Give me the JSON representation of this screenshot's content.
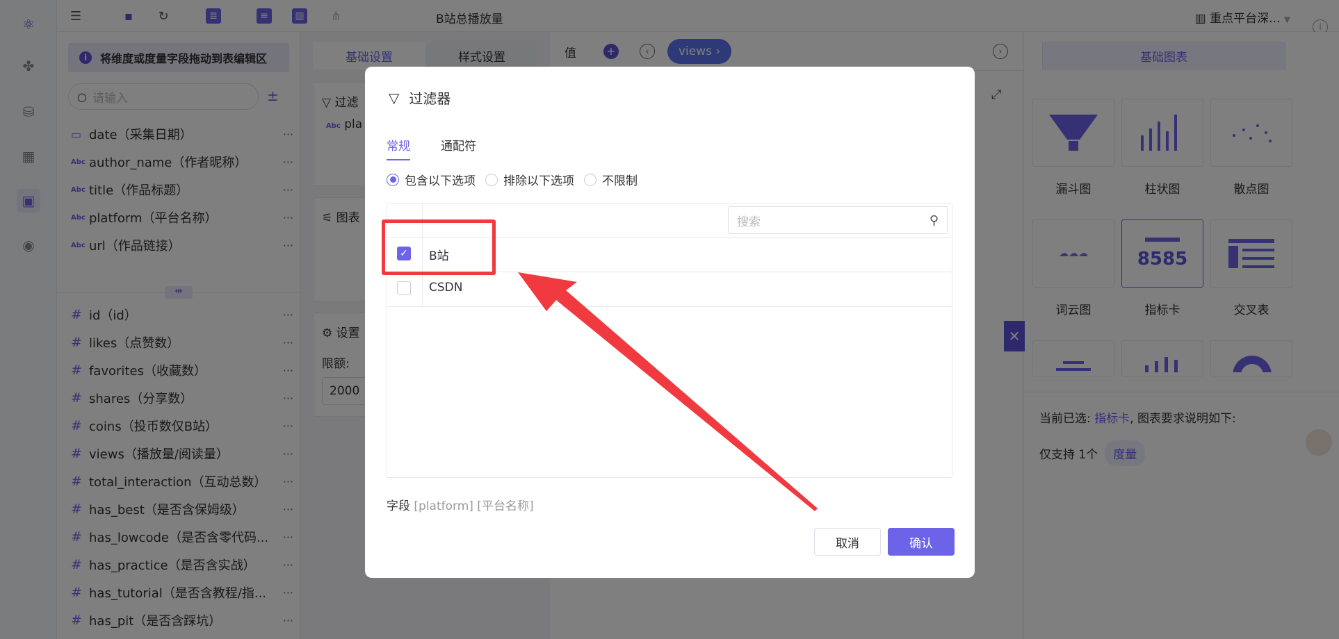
{
  "app": {
    "report_title": "B站总播放量",
    "workspace": "重点平台深..."
  },
  "left_panel": {
    "hint": "将维度或度量字段拖动到表编辑区",
    "search_placeholder": "请输入",
    "dimensions": [
      {
        "type": "date",
        "label": "date（采集日期）"
      },
      {
        "type": "Abc",
        "label": "author_name（作者昵称）"
      },
      {
        "type": "Abc",
        "label": "title（作品标题）"
      },
      {
        "type": "Abc",
        "label": "platform（平台名称）"
      },
      {
        "type": "Abc",
        "label": "url（作品链接）"
      }
    ],
    "measures": [
      {
        "label": "id（id）"
      },
      {
        "label": "likes（点赞数）"
      },
      {
        "label": "favorites（收藏数）"
      },
      {
        "label": "shares（分享数）"
      },
      {
        "label": "coins（投币数仅B站）"
      },
      {
        "label": "views（播放量/阅读量）"
      },
      {
        "label": "total_interaction（互动总数）"
      },
      {
        "label": "has_best（是否含保姆级）"
      },
      {
        "label": "has_lowcode（是否含零代码..."
      },
      {
        "label": "has_practice（是否含实战）"
      },
      {
        "label": "has_tutorial（是否含教程/指..."
      },
      {
        "label": "has_pit（是否含踩坑）"
      }
    ],
    "more": "···",
    "splitter": "⇹"
  },
  "settings_panel": {
    "tab_basic": "基础设置",
    "tab_style": "样式设置",
    "filter_title": "过滤",
    "filter_item": "pla",
    "chart_title": "图表",
    "setting_title": "设置",
    "limit_label": "限额:",
    "limit_value": "2000"
  },
  "center": {
    "value_label": "值",
    "value_pill": "views ›"
  },
  "right_panel": {
    "tab": "基础图表",
    "charts": [
      {
        "label": "漏斗图"
      },
      {
        "label": "柱状图"
      },
      {
        "label": "散点图"
      },
      {
        "label": "词云图"
      },
      {
        "label": "指标卡"
      },
      {
        "label": "交叉表"
      }
    ],
    "metric_sample": "8585",
    "current_prefix": "当前已选:",
    "current_chart": "指标卡",
    "current_suffix": ", 图表要求说明如下:",
    "support_text": "仅支持 1个",
    "support_tag": "度量"
  },
  "modal": {
    "title": "过滤器",
    "tab_normal": "常规",
    "tab_wildcard": "通配符",
    "radio_include": "包含以下选项",
    "radio_exclude": "排除以下选项",
    "radio_unlimited": "不限制",
    "search_placeholder": "搜索",
    "options": [
      {
        "label": "B站",
        "checked": true
      },
      {
        "label": "CSDN",
        "checked": false
      }
    ],
    "field_label": "字段",
    "field_value": "[platform] [平台名称]",
    "cancel": "取消",
    "confirm": "确认"
  },
  "colors": {
    "accent": "#6c63e8",
    "highlight": "#f03a3f",
    "pill": "#5b74ee"
  }
}
